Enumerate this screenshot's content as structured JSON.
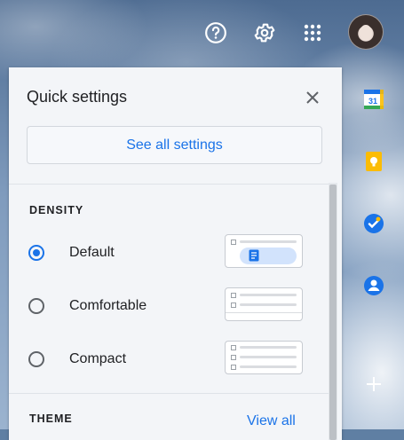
{
  "header": {
    "help_icon": "help-circle-icon",
    "settings_icon": "gear-icon",
    "apps_icon": "apps-grid-icon",
    "avatar": "account-avatar"
  },
  "quick_settings": {
    "title": "Quick settings",
    "close_icon": "close-icon",
    "see_all_label": "See all settings",
    "density": {
      "label": "DENSITY",
      "options": [
        {
          "label": "Default",
          "selected": true
        },
        {
          "label": "Comfortable",
          "selected": false
        },
        {
          "label": "Compact",
          "selected": false
        }
      ]
    },
    "theme": {
      "label": "THEME",
      "view_all_label": "View all"
    }
  },
  "side_panel": {
    "items": [
      {
        "icon": "calendar-icon",
        "text": "31"
      },
      {
        "icon": "keep-icon"
      },
      {
        "icon": "tasks-icon"
      },
      {
        "icon": "contacts-icon"
      },
      {
        "icon": "add-icon"
      }
    ]
  },
  "colors": {
    "accent": "#1a73e8",
    "panel_bg": "#f3f5f8"
  }
}
